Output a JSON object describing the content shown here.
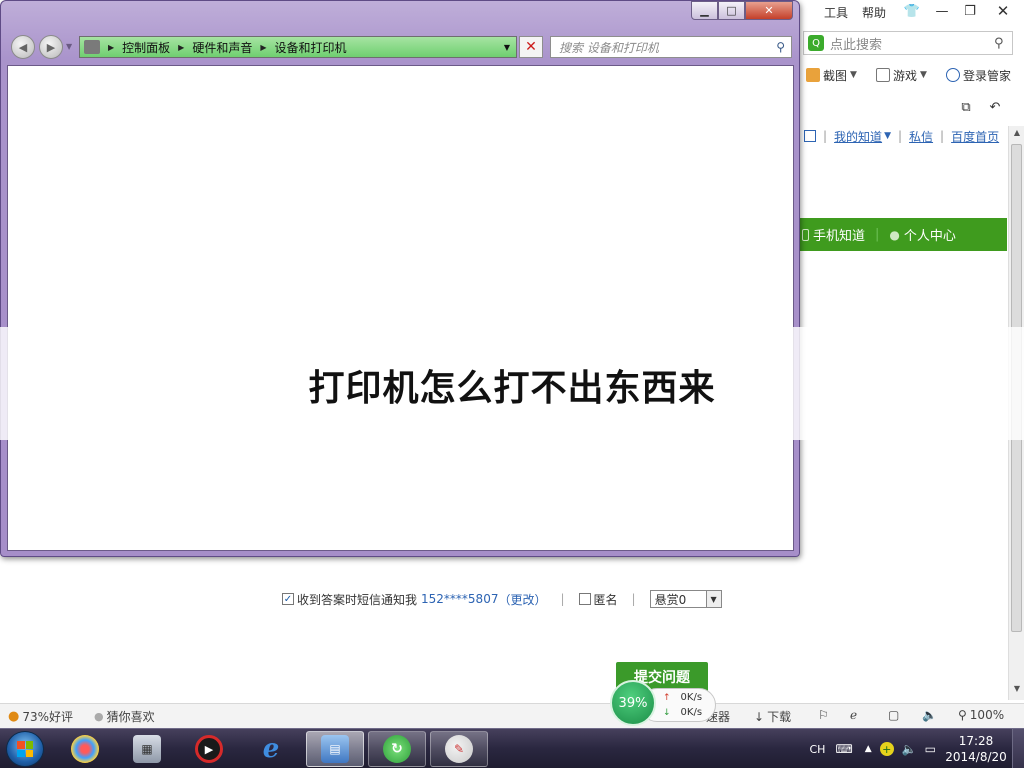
{
  "browser": {
    "menu": {
      "tools": "工具",
      "help": "帮助"
    },
    "search_placeholder": "点此搜索",
    "toolbar": {
      "screenshot": "截图",
      "games": "游戏",
      "login_manager": "登录管家"
    },
    "page_nav": {
      "my_zhidao": "我的知道",
      "messages": "私信",
      "baidu_home": "百度首页"
    },
    "green_bar": {
      "mobile_zhidao": "手机知道",
      "personal_center": "个人中心"
    },
    "form": {
      "sms_notify": "收到答案时短信通知我",
      "phone": "152****5807",
      "change": "（更改）",
      "anonymous": "匿名",
      "reward": "悬赏0",
      "submit": "提交问题"
    },
    "statusbar": {
      "rating": "73%好评",
      "guess": "猜你喜欢",
      "accelerator": "速器",
      "download": "下载",
      "zoom": "100%"
    }
  },
  "explorer": {
    "breadcrumb": [
      "控制面板",
      "硬件和声音",
      "设备和打印机"
    ],
    "search_placeholder": "搜索 设备和打印机"
  },
  "overlay": {
    "title": "打印机怎么打不出东西来"
  },
  "net_badge": {
    "percent": "39%",
    "upload": "0K/s",
    "download": "0K/s"
  },
  "taskbar": {
    "ime": "CH",
    "time": "17:28",
    "date": "2014/8/20"
  },
  "colors": {
    "explorer_frame": "#a993cb",
    "address_green": "#7cd47c",
    "baidu_green": "#3f9b1e",
    "taskbar": "#2a2740"
  }
}
